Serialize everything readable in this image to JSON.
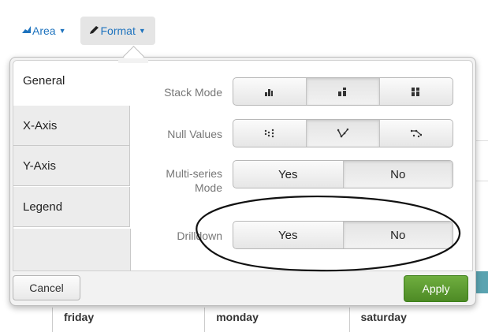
{
  "toolbar": {
    "area_label": "Area",
    "format_label": "Format",
    "area_icon": "area-chart-icon",
    "format_icon": "pencil-icon"
  },
  "tabs": [
    {
      "label": "General",
      "active": true
    },
    {
      "label": "X-Axis",
      "active": false
    },
    {
      "label": "Y-Axis",
      "active": false
    },
    {
      "label": "Legend",
      "active": false
    }
  ],
  "fields": {
    "stack_mode": {
      "label": "Stack Mode",
      "options": [
        "stack-none-icon",
        "stacked-icon",
        "stacked-100-icon"
      ],
      "selected_index": 1
    },
    "null_values": {
      "label": "Null Values",
      "options": [
        "gaps-icon",
        "zero-icon",
        "connect-icon"
      ],
      "selected_index": 1
    },
    "multi_series": {
      "label": "Multi-series Mode",
      "label_line1": "Multi-series",
      "label_line2": "Mode",
      "options": [
        "Yes",
        "No"
      ],
      "selected_index": 1
    },
    "drilldown": {
      "label": "Drilldown",
      "options": [
        "Yes",
        "No"
      ],
      "selected_index": 1
    }
  },
  "footer": {
    "cancel_label": "Cancel",
    "apply_label": "Apply"
  },
  "background_table": {
    "cells": [
      "friday",
      "monday",
      "saturday"
    ]
  },
  "colors": {
    "link": "#1e73be",
    "apply_green": "#5a9a30",
    "accent_teal": "#5aa3b0"
  }
}
